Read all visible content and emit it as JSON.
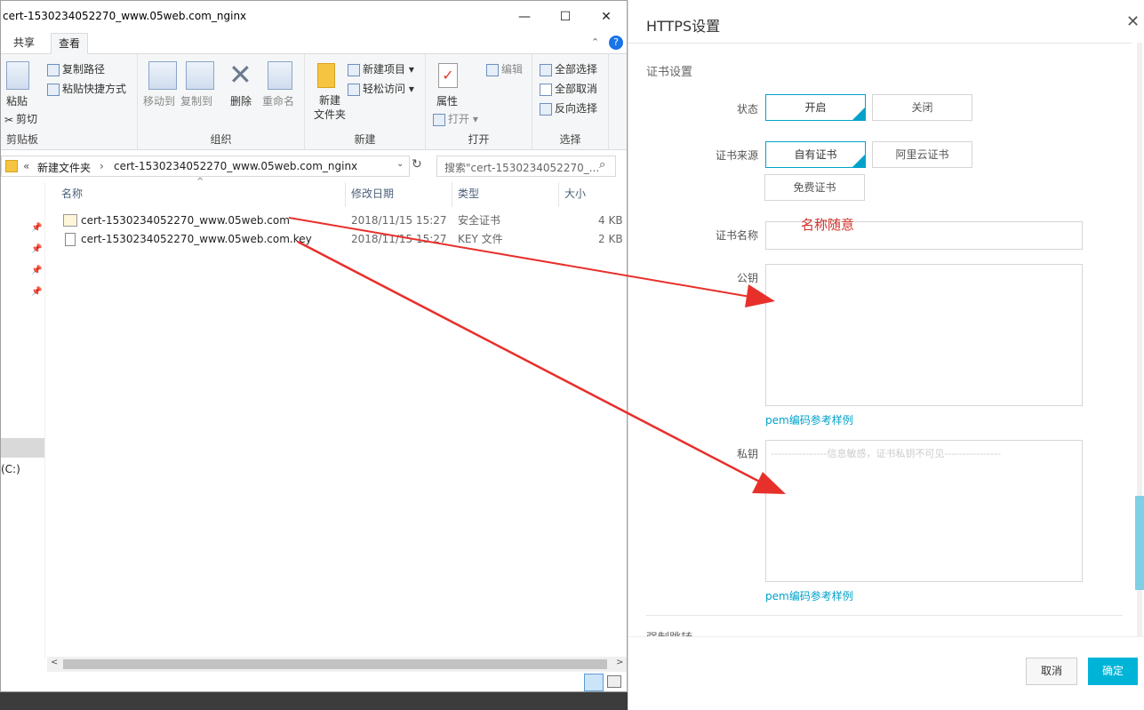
{
  "explorer": {
    "title": "cert-1530234052270_www.05web.com_nginx",
    "window_controls": {
      "minimize": "—",
      "maximize": "☐",
      "close": "✕"
    },
    "tabs": [
      "共享",
      "查看"
    ],
    "ribbon": {
      "clipboard": {
        "paste": "粘贴",
        "copy_path": "复制路径",
        "paste_shortcut": "粘贴快捷方式",
        "cut": "剪切",
        "label": "剪贴板"
      },
      "organize": {
        "move_to": "移动到",
        "copy_to": "复制到",
        "delete": "删除",
        "rename": "重命名",
        "label": "组织"
      },
      "new": {
        "new_item": "新建项目 ▾",
        "easy_access": "轻松访问 ▾",
        "new_folder_line1": "新建",
        "new_folder_line2": "文件夹",
        "label": "新建"
      },
      "open": {
        "properties": "属性",
        "open": "打开 ▾",
        "edit": "编辑",
        "label": "打开"
      },
      "select": {
        "select_all": "全部选择",
        "select_none": "全部取消",
        "invert": "反向选择",
        "label": "选择"
      }
    },
    "address": {
      "prefix": "«",
      "crumb1": "新建文件夹",
      "sep": "›",
      "crumb2": "cert-1530234052270_www.05web.com_nginx"
    },
    "search_placeholder": "搜索\"cert-1530234052270_...",
    "columns": {
      "name": "名称",
      "modified": "修改日期",
      "type": "类型",
      "size": "大小"
    },
    "files": [
      {
        "name": "cert-1530234052270_www.05web.com",
        "modified": "2018/11/15 15:27",
        "type": "安全证书",
        "size": "4 KB"
      },
      {
        "name": "cert-1530234052270_www.05web.com.key",
        "modified": "2018/11/15 15:27",
        "type": "KEY 文件",
        "size": "2 KB"
      }
    ],
    "nav_drive": "(C:)"
  },
  "dialog": {
    "title": "HTTPS设置",
    "section": "证书设置",
    "status": {
      "label": "状态",
      "on": "开启",
      "off": "关闭"
    },
    "source": {
      "label": "证书来源",
      "own": "自有证书",
      "aliyun": "阿里云证书",
      "free": "免费证书"
    },
    "cert_name": {
      "label": "证书名称",
      "annotation": "名称随意"
    },
    "public_key": {
      "label": "公钥",
      "link": "pem编码参考样例"
    },
    "private_key": {
      "label": "私钥",
      "placeholder": "----------------信息敏感，证书私钥不可见----------------",
      "link": "pem编码参考样例"
    },
    "force_redirect": "强制跳转",
    "buttons": {
      "cancel": "取消",
      "ok": "确定"
    }
  },
  "colors": {
    "accent": "#00a2ca",
    "arrow": "#e8302b",
    "ok_button": "#00b4d8"
  }
}
